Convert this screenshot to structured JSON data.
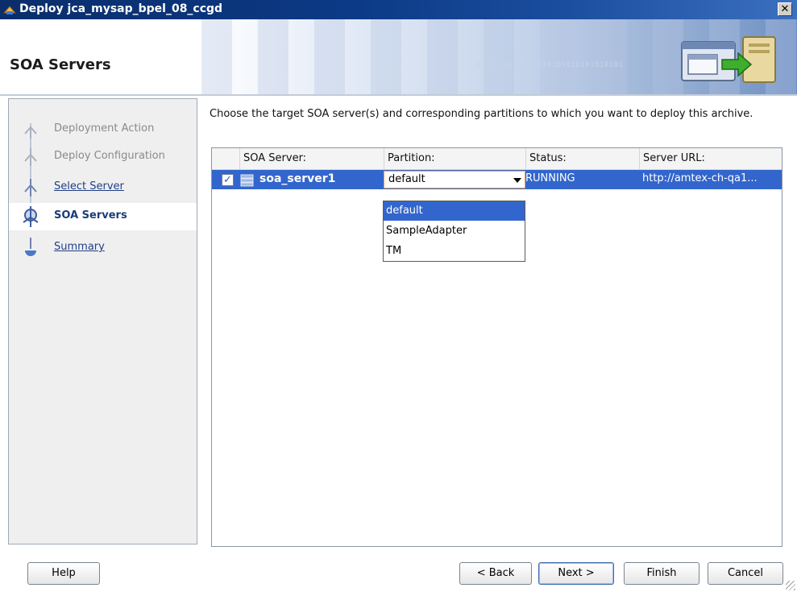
{
  "window": {
    "title": "Deploy jca_mysap_bpel_08_ccgd",
    "close_symbol": "✕"
  },
  "banner": {
    "page_title": "SOA Servers",
    "binary_text": "0101010100001010101010101010101",
    "graphic_icon": "deploy-graphic-icon"
  },
  "nav": {
    "items": [
      {
        "label": "Deployment Action",
        "state": "disabled"
      },
      {
        "label": "Deploy Configuration",
        "state": "disabled"
      },
      {
        "label": "Select Server",
        "state": "link"
      },
      {
        "label": "SOA Servers",
        "state": "active"
      },
      {
        "label": "Summary",
        "state": "link"
      }
    ]
  },
  "main": {
    "instructions": "Choose the target SOA server(s) and corresponding partitions to which you want to deploy this archive.",
    "table": {
      "headers": [
        "SOA Server:",
        "Partition:",
        "Status:",
        "Server URL:"
      ],
      "rows": [
        {
          "checked": true,
          "checkmark": "✓",
          "server": "soa_server1",
          "partition": "default",
          "status": "RUNNING",
          "url": "http://amtex-ch-qa1..."
        }
      ]
    },
    "partition_dropdown": {
      "options": [
        "default",
        "SampleAdapter",
        "TM"
      ],
      "selected": "default"
    }
  },
  "buttons": {
    "help": "Help",
    "back": "< Back",
    "next": "Next >",
    "finish": "Finish",
    "cancel": "Cancel"
  },
  "colors": {
    "selection": "#3366cc",
    "title_bar": "#0c3a86",
    "active_nav_text": "#1b3c7a"
  }
}
